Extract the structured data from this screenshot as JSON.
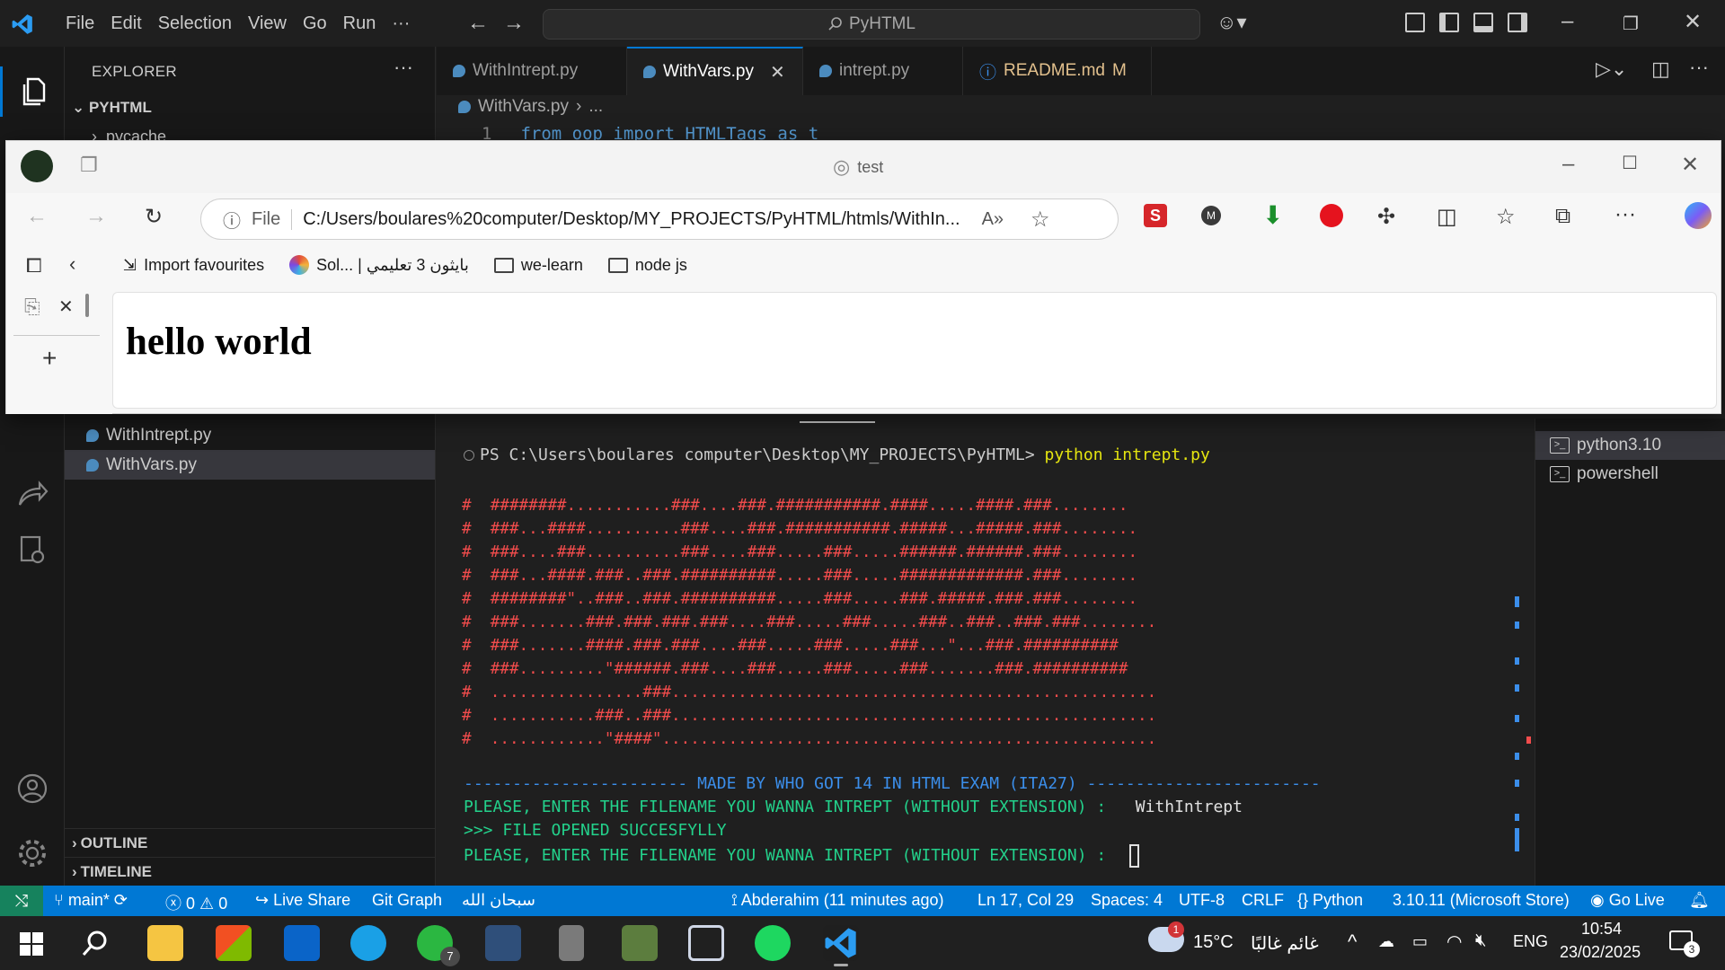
{
  "titlebar": {
    "menu": [
      "File",
      "Edit",
      "Selection",
      "View",
      "Go",
      "Run",
      "···"
    ],
    "command_center": "PyHTML"
  },
  "sidebar": {
    "title": "EXPLORER",
    "root": "PYHTML",
    "pycache": "pycache",
    "files": [
      "WithIntrept.py",
      "WithVars.py"
    ],
    "outline": "OUTLINE",
    "timeline": "TIMELINE"
  },
  "tabs": [
    {
      "label": "WithIntrept.py"
    },
    {
      "label": "WithVars.py"
    },
    {
      "label": "intrept.py"
    },
    {
      "label": "README.md",
      "badge": "M"
    }
  ],
  "breadcrumb": {
    "file": "WithVars.py",
    "rest": "..."
  },
  "code": {
    "line_no": "1",
    "text": "from oop import HTMLTags as t"
  },
  "terminal": {
    "prompt": "PS C:\\Users\\boulares computer\\Desktop\\MY_PROJECTS\\PyHTML> ",
    "command": "python intrept.py",
    "ascii_art": "#  ########...........###....###.###########.####.....####.###........\n#  ###...####..........###....###.###########.#####...#####.###........\n#  ###....###..........###....###.....###.....######.######.###........\n#  ###...####.###..###.##########.....###.....#############.###........\n#  ########\"..###..###.##########.....###.....###.#####.###.###........\n#  ###.......###.###.###.###....###.....###.....###..###..###.###........\n#  ###.......####.###.###....###.....###.....###...\"...###.##########\n#  ###.........\"######.###....###.....###.....###.......###.##########\n#  ................###...................................................\n#  ...........###..###...................................................\n#  ............\"####\"....................................................",
    "made_by": "----------------------- MADE BY WHO GOT 14 IN HTML EXAM (ITA27) ------------------------",
    "ask1": "PLEASE, ENTER THE FILENAME YOU WANNA INTREPT (WITHOUT EXTENSION) :   ",
    "answer1": "WithIntrept",
    "opened": ">>> FILE OPENED SUCCESFYLLY",
    "ask2": "PLEASE, ENTER THE FILENAME YOU WANNA INTREPT (WITHOUT EXTENSION) :  ",
    "sessions": [
      "python3.10",
      "powershell"
    ]
  },
  "statusbar": {
    "branch": "main*",
    "errors": "0",
    "warnings": "0",
    "live_share": "Live Share",
    "git_graph": "Git Graph",
    "arabic": "سبحان الله",
    "author": "Abderahim (11 minutes ago)",
    "position": "Ln 17, Col 29",
    "spaces": "Spaces: 4",
    "encoding": "UTF-8",
    "eol": "CRLF",
    "language": "Python",
    "interpreter": "3.10.11 (Microsoft Store)",
    "go_live": "Go Live"
  },
  "browser": {
    "title": "test",
    "address_prefix": "File",
    "url": "C:/Users/boulares%20computer/Desktop/MY_PROJECTS/PyHTML/htmls/WithIn...",
    "bookmarks": [
      "Import favourites",
      "Sol... | بايثون 3 تعليمي",
      "we-learn",
      "node js"
    ],
    "page_heading": "hello world"
  },
  "taskbar": {
    "weather": "15°C",
    "weather_text": "غائم غالبًا",
    "weather_badge": "1",
    "whatsapp_badge": "7",
    "language": "ENG",
    "time": "10:54",
    "date": "23/02/2025",
    "notif_count": "3"
  },
  "colors": {
    "accent": "#0078d4",
    "ascii_red": "#f14c4c",
    "term_blue": "#3b8eea",
    "term_green": "#23d18b",
    "cmd_yellow": "#e5e510"
  }
}
